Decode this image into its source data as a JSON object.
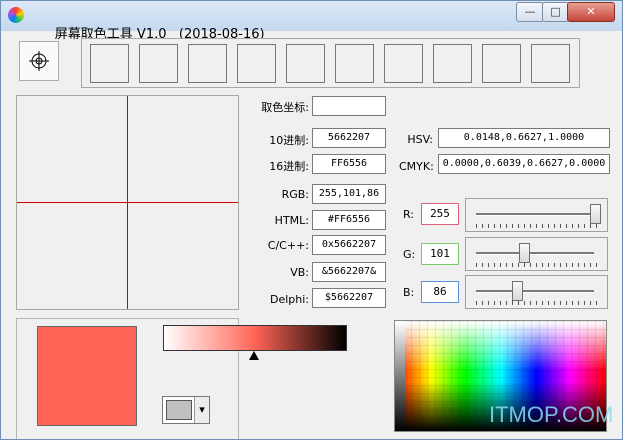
{
  "window": {
    "title": "屏幕取色工具 V1.0",
    "date": "(2018-08-16)",
    "minimize_glyph": "—",
    "maximize_glyph": "□",
    "close_glyph": "✕"
  },
  "history_swatch_count": 10,
  "crosshair_color": "#cc0000",
  "labels": {
    "coord": "取色坐标:",
    "dec": "10进制:",
    "hex": "16进制:",
    "rgb": "RGB:",
    "html": "HTML:",
    "c": "C/C++:",
    "vb": "VB:",
    "delphi": "Delphi:",
    "hsv": "HSV:",
    "cmyk": "CMYK:",
    "r": "R:",
    "g": "G:",
    "b": "B:"
  },
  "values": {
    "coord": "",
    "dec": "5662207",
    "hex": "FF6556",
    "rgb": "255,101,86",
    "html": "#FF6556",
    "c": "0x5662207",
    "vb": "&5662207&",
    "delphi": "$5662207",
    "hsv": "0.0148,0.6627,1.0000",
    "cmyk": "0.0000,0.6039,0.6627,0.0000"
  },
  "rgb_sliders": {
    "r": {
      "value": "255",
      "level": 1.0,
      "border": "#e0607a"
    },
    "g": {
      "value": "101",
      "level": 0.396,
      "border": "#7ac86a"
    },
    "b": {
      "value": "86",
      "level": 0.337,
      "border": "#5f8fd8"
    }
  },
  "current_color": "#ff6556",
  "gradient_marker_level": 0.5,
  "color_dropdown": {
    "swatch": "#c0c0c0",
    "arrow": "▾"
  },
  "watermark": "ITMOP.COM"
}
